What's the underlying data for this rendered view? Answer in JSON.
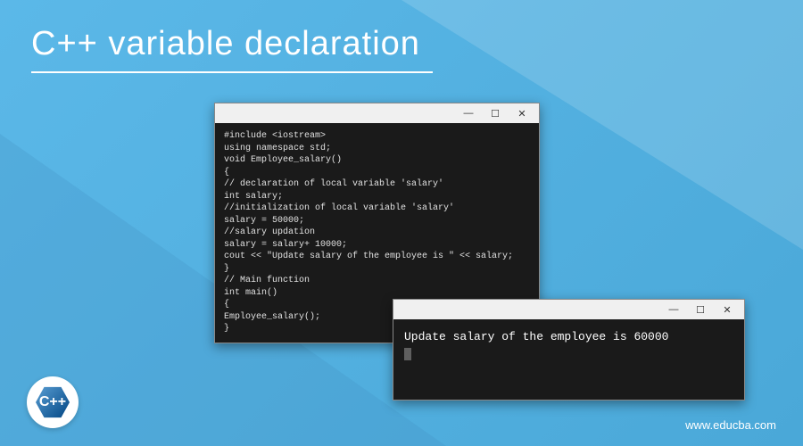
{
  "header": {
    "title": "C++ variable declaration"
  },
  "code_window": {
    "controls": {
      "minimize": "—",
      "maximize": "☐",
      "close": "✕"
    },
    "lines": [
      "#include <iostream>",
      "using namespace std;",
      "void Employee_salary()",
      "{",
      "// declaration of local variable 'salary'",
      "int salary;",
      "//initialization of local variable 'salary'",
      "salary = 50000;",
      "//salary updation",
      "salary = salary+ 10000;",
      "cout << \"Update salary of the employee is \" << salary;",
      "}",
      "// Main function",
      "int main()",
      "{",
      "Employee_salary();",
      "}"
    ]
  },
  "output_window": {
    "controls": {
      "minimize": "—",
      "maximize": "☐",
      "close": "✕"
    },
    "text": "Update salary of the employee is 60000"
  },
  "logo": {
    "label": "C++"
  },
  "footer": {
    "url": "www.educba.com"
  }
}
